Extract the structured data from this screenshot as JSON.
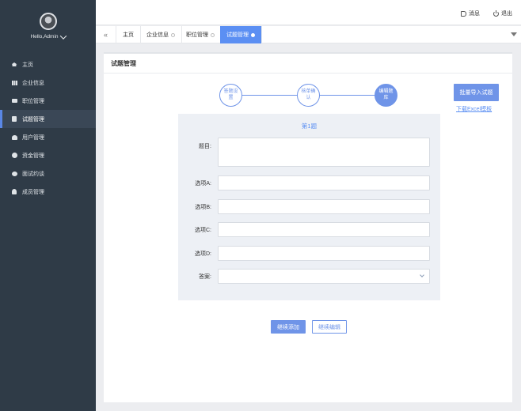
{
  "sidebar": {
    "username": "Hello,Admin",
    "items": [
      {
        "label": "主页",
        "icon": "home-icon"
      },
      {
        "label": "企业信息",
        "icon": "bar-chart-icon"
      },
      {
        "label": "职位管理",
        "icon": "briefcase-icon"
      },
      {
        "label": "试题管理",
        "icon": "document-icon",
        "active": true
      },
      {
        "label": "用户管理",
        "icon": "users-icon"
      },
      {
        "label": "资金管理",
        "icon": "coin-icon"
      },
      {
        "label": "面试约谈",
        "icon": "chat-icon"
      },
      {
        "label": "成员管理",
        "icon": "person-icon"
      }
    ]
  },
  "topbar": {
    "message_label": "消息",
    "logout_label": "退出"
  },
  "tabs": [
    {
      "label": "主页"
    },
    {
      "label": "企业信息"
    },
    {
      "label": "职位管理"
    },
    {
      "label": "试题管理",
      "active": true
    }
  ],
  "panel": {
    "title": "试题管理"
  },
  "stepper": {
    "steps": [
      {
        "label": "答题设置"
      },
      {
        "label": "核单确认"
      },
      {
        "label": "编辑题库",
        "active": true
      }
    ]
  },
  "actions": {
    "import_label": "批量导入试题",
    "template_link": "下载Excel模板"
  },
  "form": {
    "question_title": "第1题",
    "fields": {
      "stem_label": "题目:",
      "a_label": "选项A:",
      "b_label": "选项B:",
      "c_label": "选项C:",
      "d_label": "选项D:",
      "answer_label": "答案:"
    }
  },
  "buttons": {
    "continue_label": "继续添加",
    "edit_label": "继续编辑"
  },
  "colors": {
    "accent": "#6f94e8",
    "sidebar_bg": "#2f3b47",
    "form_bg": "#edf0f5"
  }
}
